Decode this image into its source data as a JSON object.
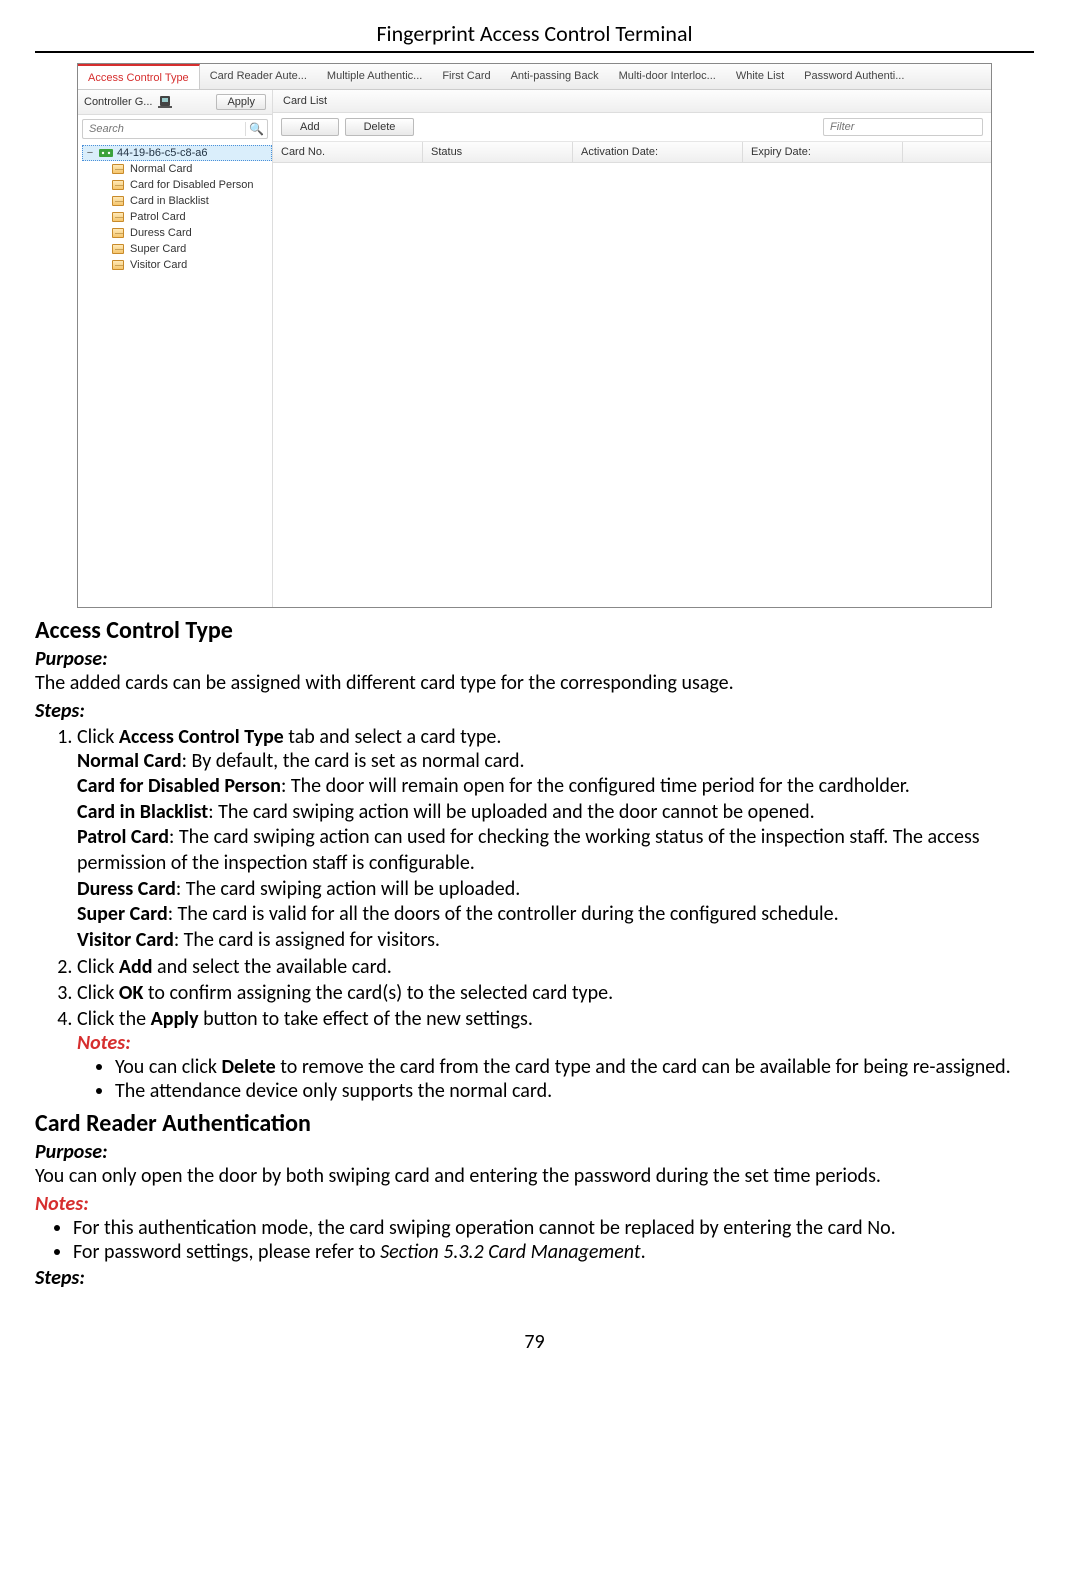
{
  "doc_title": "Fingerprint Access Control Terminal",
  "page_number": "79",
  "screenshot": {
    "tabs": [
      "Access Control Type",
      "Card Reader Aute...",
      "Multiple Authentic...",
      "First Card",
      "Anti-passing Back",
      "Multi-door Interloc...",
      "White List",
      "Password Authenti..."
    ],
    "left": {
      "controller_label": "Controller G...",
      "apply_btn": "Apply",
      "search_placeholder": "Search",
      "root_node": "44-19-b6-c5-c8-a6",
      "items": [
        "Normal Card",
        "Card for Disabled Person",
        "Card in Blacklist",
        "Patrol Card",
        "Duress Card",
        "Super Card",
        "Visitor Card"
      ]
    },
    "right": {
      "title": "Card List",
      "add_btn": "Add",
      "delete_btn": "Delete",
      "filter_placeholder": "Filter",
      "columns": [
        "Card No.",
        "Status",
        "Activation Date:",
        "Expiry Date:"
      ]
    }
  },
  "s1_heading": "Access Control Type",
  "purpose_lbl": "Purpose:",
  "s1_purpose": "The added cards can be assigned with different card type for the corresponding usage.",
  "steps_lbl": "Steps:",
  "s1_step1_lead": "Click ",
  "s1_step1_b": "Access Control Type",
  "s1_step1_tail": " tab and select a card type.",
  "ct_normal_b": "Normal Card",
  "ct_normal_t": ": By default, the card is set as normal card.",
  "ct_dis_b": "Card for Disabled Person",
  "ct_dis_t": ": The door will remain open for the configured time period for the cardholder.",
  "ct_black_b": "Card in Blacklist",
  "ct_black_t": ": The card swiping action will be uploaded and the door cannot be opened.",
  "ct_patrol_b": "Patrol Card",
  "ct_patrol_t": ": The card swiping action can used for checking the working status of the inspection staff. The access permission of the inspection staff is configurable.",
  "ct_duress_b": "Duress Card",
  "ct_duress_t": ": The card swiping action will be uploaded.",
  "ct_super_b": "Super Card",
  "ct_super_t": ": The card is valid for all the doors of the controller during the configured schedule.",
  "ct_visitor_b": "Visitor Card",
  "ct_visitor_t": ": The card is assigned for visitors.",
  "s1_step2_a": "Click ",
  "s1_step2_b": "Add",
  "s1_step2_c": " and select the available card.",
  "s1_step3_a": "Click ",
  "s1_step3_b": "OK",
  "s1_step3_c": " to confirm assigning the card(s) to the selected card type.",
  "s1_step4_a": "Click the ",
  "s1_step4_b": "Apply",
  "s1_step4_c": " button to take effect of the new settings.",
  "notes_lbl": "Notes:",
  "note1_a": "You can click ",
  "note1_b": "Delete",
  "note1_c": " to remove the card from the card type and the card can be available for being re-assigned.",
  "note2": "The attendance device only supports the normal card.",
  "s2_heading": "Card Reader Authentication",
  "s2_purpose": "You can only open the door by both swiping card and entering the password during the set time periods.",
  "s2_note1": "For this authentication mode, the card swiping operation cannot be replaced by entering the card No.",
  "s2_note2_a": "For password settings, please refer to ",
  "s2_note2_i": "Section 5.3.2 Card Management",
  "s2_note2_c": "."
}
